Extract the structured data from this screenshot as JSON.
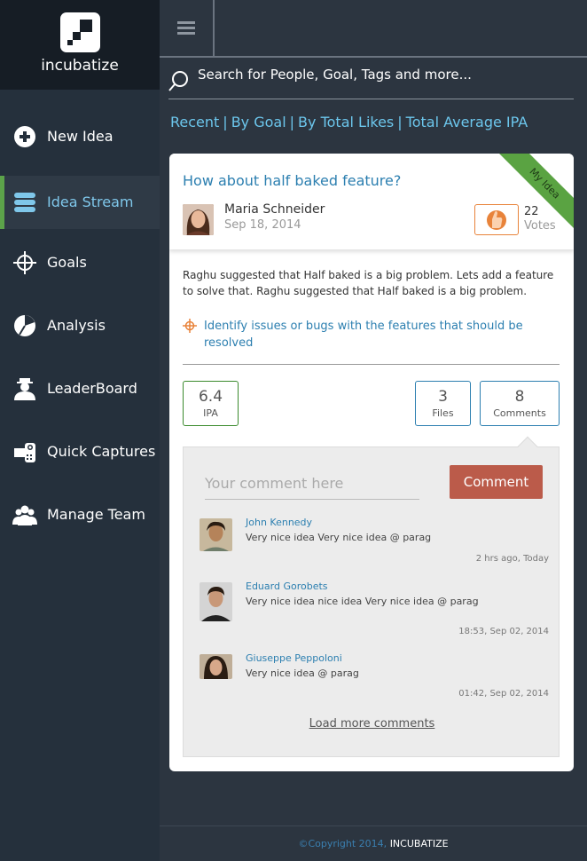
{
  "brand": {
    "logo_text": "incubatize"
  },
  "sidebar": {
    "items": [
      {
        "label": "New Idea",
        "icon": "plus-circle-icon"
      },
      {
        "label": "Idea Stream",
        "icon": "stack-icon",
        "active": true
      },
      {
        "label": "Goals",
        "icon": "crosshair-icon"
      },
      {
        "label": "Analysis",
        "icon": "pie-chart-icon"
      },
      {
        "label": "LeaderBoard",
        "icon": "person-icon"
      },
      {
        "label": "Quick Captures",
        "icon": "camera-icon"
      },
      {
        "label": "Manage Team",
        "icon": "team-icon"
      }
    ]
  },
  "search": {
    "placeholder": "Search for People, Goal, Tags and more..."
  },
  "filters": [
    "Recent",
    "By Goal",
    "By Total Likes",
    "Total Average IPA"
  ],
  "idea": {
    "title": "How about half baked feature?",
    "ribbon": "My Idea",
    "author": "Maria Schneider",
    "date": "Sep 18, 2014",
    "votes": "22",
    "votes_label": "Votes",
    "description": "Raghu suggested that Half baked is a big problem. Lets add a feature to solve that. Raghu suggested that Half baked is a big problem.",
    "goal": "Identify issues or bugs with the features that should be resolved",
    "stats": {
      "ipa": {
        "value": "6.4",
        "label": "IPA"
      },
      "files": {
        "value": "3",
        "label": "Files"
      },
      "comments": {
        "value": "8",
        "label": "Comments"
      }
    }
  },
  "comments": {
    "placeholder": "Your comment here",
    "button": "Comment",
    "items": [
      {
        "name": "John Kennedy",
        "text": "Very nice idea Very nice idea @ parag",
        "time": "2 hrs ago, Today"
      },
      {
        "name": "Eduard Gorobets",
        "text": "Very nice idea nice idea Very nice idea @ parag",
        "time": "18:53, Sep 02, 2014"
      },
      {
        "name": "Giuseppe Peppoloni",
        "text": "Very nice idea @ parag",
        "time": "01:42, Sep 02, 2014"
      }
    ],
    "load_more": "Load more comments"
  },
  "footer": {
    "copyright": "©Copyright 2014,",
    "brand": "INCUBATIZE"
  },
  "colors": {
    "accent_blue": "#6cc6ec",
    "active_green": "#5ca34a",
    "comment_button": "#bb5b4a",
    "like_orange": "#e8833a"
  }
}
